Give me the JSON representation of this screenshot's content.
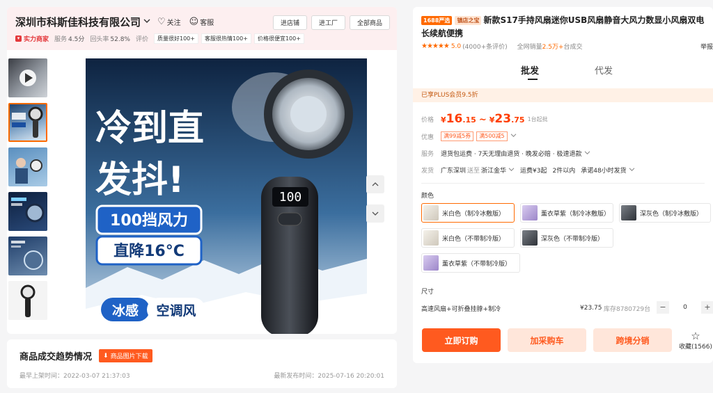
{
  "shop": {
    "name": "深圳市科斯佳科技有限公司",
    "follow_label": "关注",
    "service_label": "客服",
    "buttons": [
      "进店铺",
      "进工厂",
      "全部商品"
    ],
    "strong_badge": "实力商家",
    "stats": [
      {
        "label": "服务",
        "value": "4.5分"
      },
      {
        "label": "回头率",
        "value": "52.8%"
      },
      {
        "label": "评价",
        "value": ""
      }
    ],
    "tags": [
      "质量很好100+",
      "客服很热情100+",
      "价格很便宜100+"
    ]
  },
  "main_image": {
    "headline_1": "冷到直",
    "headline_2": "发抖!",
    "badge_top": "100挡风力",
    "badge_bottom": "直降16°C",
    "bottom_left": "冰感",
    "bottom_right": "空调风",
    "display_digits": "100"
  },
  "trend": {
    "title": "商品成交趋势情况",
    "download_label": "商品图片下载",
    "first_listed": "最早上架时间：2022-03-07 21:37:03",
    "latest_published": "最新发布时间：2025-07-16 20:20:01"
  },
  "product": {
    "badge_1688": "1688严选",
    "badge_store": "镇店之宝",
    "title": "新款S17手持风扇迷你USB风扇静音大风力数显小风扇双电长续航便携",
    "stars": "★★★★★",
    "score": "5.0",
    "reviews": "(4000+条评价)",
    "sales_prefix": "全网销量",
    "sales_value": "2.5万+",
    "sales_suffix": "台成交",
    "report_label": "举报",
    "tabs": [
      "批发",
      "代发"
    ],
    "plus_bar": "已享PLUS会员9.5折",
    "price_label": "价格",
    "price_low_int": "16",
    "price_low_dec": ".15",
    "price_high_int": "23",
    "price_high_dec": ".75",
    "currency": "¥",
    "moq": "1台起批",
    "promo_label": "优惠",
    "coupons": [
      "满99减5券",
      "满500减5"
    ],
    "service_label": "服务",
    "service_text": "退货包运费 · 7天无理由退货 · 晚发必赔 · 极速退款",
    "ship_label": "发货",
    "ship_from": "广东深圳",
    "ship_to_word": "送至",
    "ship_to": "浙江金华",
    "freight": "运费¥3起",
    "ship_within": "2件以内",
    "promise": "承诺48小时发货",
    "color_label": "颜色",
    "colors": [
      "米白色（制冷冰敷版）",
      "薰衣草紫（制冷冰敷版）",
      "深灰色（制冷冰敷版）",
      "米白色（不带制冷版）",
      "深灰色（不带制冷版）",
      "薰衣草紫（不带制冷版）"
    ],
    "size_label": "尺寸",
    "size_name": "高速风扇+可折叠挂脖+制冷",
    "size_price": "¥23.75",
    "size_stock": "库存8780729台",
    "qty": "0",
    "buy_now": "立即订购",
    "add_cart": "加采购车",
    "cross_border": "跨境分销",
    "favorite": "收藏(1566)"
  },
  "colors": {
    "accent": "#ff5a1f",
    "header_bg": "#fdeff0"
  }
}
